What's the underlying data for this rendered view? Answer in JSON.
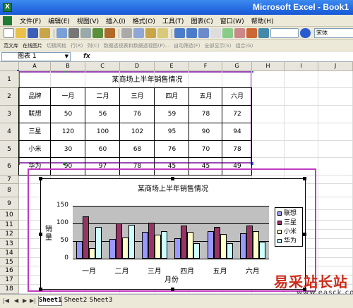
{
  "window": {
    "title": "Microsoft Excel - Book1",
    "icon": "excel-app-icon"
  },
  "menu": [
    "文件(F)",
    "编辑(E)",
    "视图(V)",
    "插入(I)",
    "格式(O)",
    "工具(T)",
    "图表(C)",
    "窗口(W)",
    "帮助(H)"
  ],
  "toolbar": {
    "font_value": "宋体",
    "icons": [
      "new-icon",
      "open-icon",
      "save-icon",
      "permission-icon",
      "email-icon",
      "print-icon",
      "print-preview-icon",
      "spelling-icon",
      "research-icon",
      "cut-icon",
      "copy-icon",
      "paste-icon",
      "format-painter-icon",
      "undo-icon",
      "redo-icon",
      "hyperlink-icon",
      "autosum-icon",
      "sort-ascending-icon",
      "sort-descending-icon",
      "chart-wizard-icon",
      "drawing-icon",
      "zoom-icon",
      "help-icon"
    ],
    "row2": [
      {
        "label": "范文库",
        "dim": false
      },
      {
        "label": "在线图片",
        "dim": false
      },
      {
        "label": "切换网格",
        "dim": true
      },
      {
        "label": "行(R)",
        "dim": true
      },
      {
        "label": "列(C)",
        "dim": true
      },
      {
        "label": "数据透视表和数据透视图(P)...",
        "dim": true
      },
      {
        "label": "自动筛选(F)",
        "dim": true
      },
      {
        "label": "全部显示(S)",
        "dim": true
      },
      {
        "label": "组合(G)",
        "dim": true
      }
    ]
  },
  "formula_bar": {
    "name_box": "图表 1",
    "fx": "fx",
    "content": ""
  },
  "columns": [
    "A",
    "B",
    "C",
    "D",
    "E",
    "F",
    "G",
    "H",
    "I",
    "J"
  ],
  "rows": [
    "1",
    "2",
    "3",
    "4",
    "5",
    "6",
    "7",
    "8",
    "9",
    "10",
    "11",
    "12",
    "13",
    "14",
    "15",
    "16",
    "17",
    "18"
  ],
  "table": {
    "title": "某商场上半年销售情况",
    "header": [
      "品牌",
      "一月",
      "二月",
      "三月",
      "四月",
      "五月",
      "六月"
    ],
    "rows": [
      [
        "联想",
        "50",
        "56",
        "76",
        "59",
        "78",
        "72"
      ],
      [
        "三星",
        "120",
        "100",
        "102",
        "95",
        "90",
        "94"
      ],
      [
        "小米",
        "30",
        "60",
        "68",
        "76",
        "70",
        "78"
      ],
      [
        "华为",
        "90",
        "97",
        "78",
        "45",
        "45",
        "49"
      ]
    ]
  },
  "chart_data": {
    "type": "bar",
    "title": "某商场上半年销售情况",
    "xlabel": "月份",
    "ylabel": "销量",
    "categories": [
      "一月",
      "二月",
      "三月",
      "四月",
      "五月",
      "六月"
    ],
    "yticks": [
      "150",
      "100",
      "50",
      "0"
    ],
    "ylim": [
      0,
      150
    ],
    "grid": true,
    "legend_position": "right",
    "series": [
      {
        "name": "联想",
        "color": "#9999ff",
        "values": [
          50,
          56,
          76,
          59,
          78,
          72
        ]
      },
      {
        "name": "三星",
        "color": "#993366",
        "values": [
          120,
          100,
          102,
          95,
          90,
          94
        ]
      },
      {
        "name": "小米",
        "color": "#ffffcc",
        "values": [
          30,
          60,
          68,
          76,
          70,
          78
        ]
      },
      {
        "name": "华为",
        "color": "#ccffff",
        "values": [
          90,
          97,
          78,
          45,
          45,
          49
        ]
      }
    ]
  },
  "sheet_tabs": [
    "Sheet1",
    "Sheet2",
    "Sheet3"
  ],
  "active_sheet": "Sheet1",
  "watermark": {
    "zh": "易采站长站",
    "en": "www.easck.com"
  }
}
